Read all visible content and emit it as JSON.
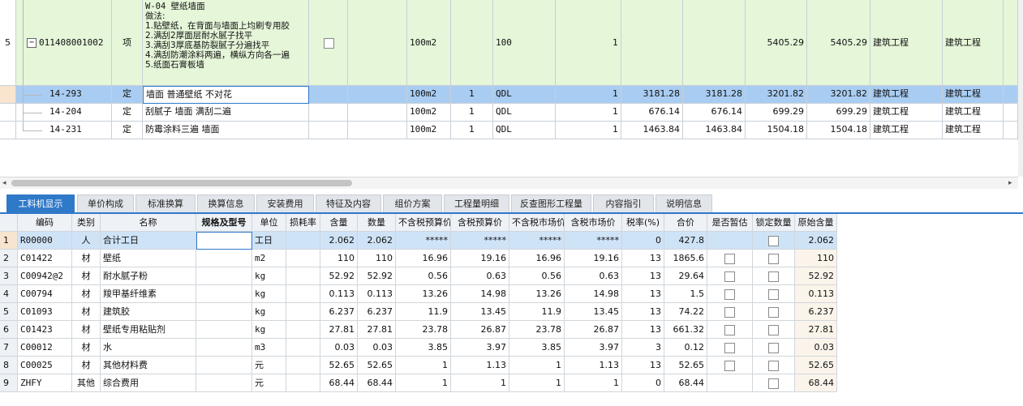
{
  "top_grid": {
    "rows": [
      {
        "index": "5",
        "code": "011408001002",
        "type": "项",
        "name_lines": [
          "W-04 壁纸墙面",
          "做法:",
          "1.贴壁纸，在背面与墙面上均刷专用胶",
          "2.满刮2厚面层耐水腻子找平",
          "3.满刮3厚底基防裂腻子分遍找平",
          "4.满刮防潮涂料两遍，横纵方向各一遍",
          "5.纸面石膏板墙"
        ],
        "unit": "100m2",
        "qty_label": "",
        "qty": "100",
        "factor": "1",
        "unit_price": "",
        "total_price": "",
        "price_incl": "5405.29",
        "total_incl": "5405.29",
        "major": "建筑工程",
        "major2": "建筑工程",
        "expanded_symbol": "−"
      },
      {
        "index": "",
        "code": "14-293",
        "type": "定",
        "name": "墙面 普通壁纸 不对花",
        "unit": "100m2",
        "qty_label": "1",
        "qty": "QDL",
        "factor": "1",
        "unit_price": "3181.28",
        "total_price": "3181.28",
        "price_incl": "3201.82",
        "total_incl": "3201.82",
        "major": "建筑工程",
        "major2": "建筑工程"
      },
      {
        "index": "",
        "code": "14-204",
        "type": "定",
        "name": "刮腻子 墙面 满刮二遍",
        "unit": "100m2",
        "qty_label": "1",
        "qty": "QDL",
        "factor": "1",
        "unit_price": "676.14",
        "total_price": "676.14",
        "price_incl": "699.29",
        "total_incl": "699.29",
        "major": "建筑工程",
        "major2": "建筑工程"
      },
      {
        "index": "",
        "code": "14-231",
        "type": "定",
        "name": "防霉涂料三遍 墙面",
        "unit": "100m2",
        "qty_label": "1",
        "qty": "QDL",
        "factor": "1",
        "unit_price": "1463.84",
        "total_price": "1463.84",
        "price_incl": "1504.18",
        "total_incl": "1504.18",
        "major": "建筑工程",
        "major2": "建筑工程"
      }
    ]
  },
  "tabs": [
    "工料机显示",
    "单价构成",
    "标准换算",
    "换算信息",
    "安装费用",
    "特征及内容",
    "组价方案",
    "工程量明细",
    "反查图形工程量",
    "内容指引",
    "说明信息"
  ],
  "active_tab": 0,
  "bottom_grid": {
    "headers": [
      "",
      "编码",
      "类别",
      "名称",
      "规格及型号",
      "单位",
      "损耗率",
      "含量",
      "数量",
      "不含税预算价",
      "含税预算价",
      "不含税市场价",
      "含税市场价",
      "税率(%)",
      "合价",
      "是否暂估",
      "锁定数量",
      "原始含量"
    ],
    "rows": [
      [
        "1",
        "R00000",
        "人",
        "合计工日",
        "",
        "工日",
        "",
        "2.062",
        "2.062",
        "*****",
        "*****",
        "*****",
        "*****",
        "0",
        "427.8",
        "",
        "",
        "2.062"
      ],
      [
        "2",
        "C01422",
        "材",
        "壁纸",
        "",
        "m2",
        "",
        "110",
        "110",
        "16.96",
        "19.16",
        "16.96",
        "19.16",
        "13",
        "1865.6",
        "cb",
        "cb",
        "110"
      ],
      [
        "3",
        "C00942@2",
        "材",
        "耐水腻子粉",
        "",
        "kg",
        "",
        "52.92",
        "52.92",
        "0.56",
        "0.63",
        "0.56",
        "0.63",
        "13",
        "29.64",
        "cb",
        "cb",
        "52.92"
      ],
      [
        "4",
        "C00794",
        "材",
        "羧甲基纤维素",
        "",
        "kg",
        "",
        "0.113",
        "0.113",
        "13.26",
        "14.98",
        "13.26",
        "14.98",
        "13",
        "1.5",
        "cb",
        "cb",
        "0.113"
      ],
      [
        "5",
        "C01093",
        "材",
        "建筑胶",
        "",
        "kg",
        "",
        "6.237",
        "6.237",
        "11.9",
        "13.45",
        "11.9",
        "13.45",
        "13",
        "74.22",
        "cb",
        "cb",
        "6.237"
      ],
      [
        "6",
        "C01423",
        "材",
        "壁纸专用粘贴剂",
        "",
        "kg",
        "",
        "27.81",
        "27.81",
        "23.78",
        "26.87",
        "23.78",
        "26.87",
        "13",
        "661.32",
        "cb",
        "cb",
        "27.81"
      ],
      [
        "7",
        "C00012",
        "材",
        "水",
        "",
        "m3",
        "",
        "0.03",
        "0.03",
        "3.85",
        "3.97",
        "3.85",
        "3.97",
        "3",
        "0.12",
        "cb",
        "cb",
        "0.03"
      ],
      [
        "8",
        "C00025",
        "材",
        "其他材料费",
        "",
        "元",
        "",
        "52.65",
        "52.65",
        "1",
        "1.13",
        "1",
        "1.13",
        "13",
        "52.65",
        "cb",
        "cb",
        "52.65"
      ],
      [
        "9",
        "ZHFY",
        "其他",
        "综合费用",
        "",
        "元",
        "",
        "68.44",
        "68.44",
        "1",
        "1",
        "1",
        "1",
        "0",
        "68.44",
        "",
        "cb",
        "68.44"
      ]
    ]
  },
  "colors": {
    "row_green": "#e5f6d9",
    "row_selected": "#a9cdf2",
    "tab_active": "#2f79c9",
    "header_bg": "#eef1f5",
    "selected_cell": "#cfe3f7"
  },
  "scroll_left": "◂",
  "scroll_right": "▸"
}
